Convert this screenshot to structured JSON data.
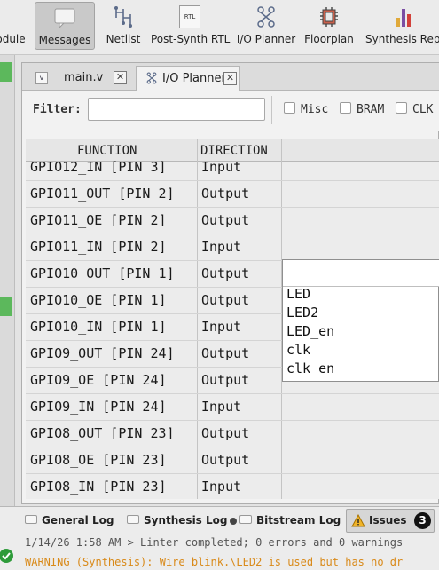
{
  "toolbar": {
    "items": [
      {
        "label": "odule",
        "icon": "module-icon"
      },
      {
        "label": "Messages",
        "icon": "messages-icon",
        "active": true
      },
      {
        "label": "Netlist",
        "icon": "netlist-icon"
      },
      {
        "label": "Post-Synth RTL",
        "icon": "rtl-icon",
        "icon_text": "RTL"
      },
      {
        "label": "I/O Planner",
        "icon": "io-planner-icon"
      },
      {
        "label": "Floorplan",
        "icon": "chip-icon"
      },
      {
        "label": "Synthesis Repo",
        "icon": "bar-chart-icon"
      }
    ]
  },
  "tabs": [
    {
      "label": "main.v",
      "icon": "verilog-file-icon",
      "close": "✕"
    },
    {
      "label": "I/O Planner",
      "icon": "io-planner-icon",
      "close": "✕",
      "active": true
    }
  ],
  "filter": {
    "label": "Filter:",
    "value": "",
    "checkboxes": [
      {
        "label": "Misc",
        "checked": false
      },
      {
        "label": "BRAM",
        "checked": false
      },
      {
        "label": "CLK",
        "checked": false
      }
    ]
  },
  "table": {
    "columns": [
      "FUNCTION",
      "DIRECTION"
    ],
    "rows": [
      {
        "function": "GPIO12_IN [PIN 3]",
        "direction": "Input"
      },
      {
        "function": "GPIO11_OUT [PIN 2]",
        "direction": "Output"
      },
      {
        "function": "GPIO11_OE [PIN 2]",
        "direction": "Output"
      },
      {
        "function": "GPIO11_IN [PIN 2]",
        "direction": "Input"
      },
      {
        "function": "GPIO10_OUT [PIN 1]",
        "direction": "Output"
      },
      {
        "function": "GPIO10_OE [PIN 1]",
        "direction": "Output"
      },
      {
        "function": "GPIO10_IN [PIN 1]",
        "direction": "Input"
      },
      {
        "function": "GPIO9_OUT [PIN 24]",
        "direction": "Output"
      },
      {
        "function": "GPIO9_OE [PIN 24]",
        "direction": "Output"
      },
      {
        "function": "GPIO9_IN [PIN 24]",
        "direction": "Input"
      },
      {
        "function": "GPIO8_OUT [PIN 23]",
        "direction": "Output"
      },
      {
        "function": "GPIO8_OE [PIN 23]",
        "direction": "Output"
      },
      {
        "function": "GPIO8_IN [PIN 23]",
        "direction": "Input"
      }
    ]
  },
  "dropdown": {
    "value": "",
    "options": [
      "LED",
      "LED2",
      "LED_en",
      "clk",
      "clk_en"
    ]
  },
  "bottom_tabs": [
    {
      "label": "General Log",
      "icon": "log-icon"
    },
    {
      "label": "Synthesis Log",
      "icon": "log-icon",
      "modified": true
    },
    {
      "label": "Bitstream Log",
      "icon": "log-icon"
    },
    {
      "label": "Issues",
      "icon": "warning-icon",
      "badge": "3",
      "active": true
    }
  ],
  "log": [
    {
      "text": "1/14/26 1:58 AM > Linter completed; 0 errors and 0 warnings",
      "color": "#555555"
    },
    {
      "text": "WARNING (Synthesis): Wire blink.\\LED2 is used but has no dr",
      "color": "#d98a1a"
    }
  ],
  "colors": {
    "accent_green": "#5cb85c",
    "warning": "#d98a1a",
    "status_ok": "#2e9b3a"
  }
}
